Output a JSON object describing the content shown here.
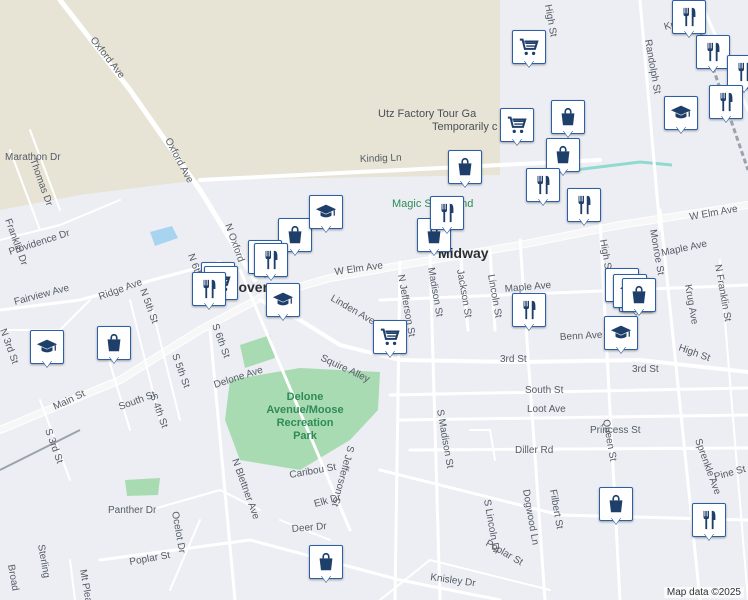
{
  "map": {
    "attribution": "Map data ©2025",
    "towns": [
      {
        "id": "hershey",
        "text": "Hanover"
      },
      {
        "id": "midway",
        "text": "Midway"
      }
    ],
    "pois": [
      {
        "id": "utz",
        "text": "Utz Factory Tour Ga"
      },
      {
        "id": "utz-status",
        "text": "Temporarily c"
      },
      {
        "id": "magic",
        "text": "Magic Skateland"
      }
    ],
    "park": [
      "Delone",
      "Avenue/Moose",
      "Recreation",
      "Park"
    ],
    "streets": [
      "Oxford Ave",
      "Oxford Ave",
      "W Elm Ave",
      "W Elm Ave",
      "Kindig Ln",
      "Main St",
      "Fairview Ave",
      "Ridge Ave",
      "Providence Dr",
      "Franklin Dr",
      "Thomas Dr",
      "Marathon Dr",
      "N 5th St",
      "N 3rd St",
      "N 6th St",
      "S 6th St",
      "S 5th St",
      "S 4th St",
      "S 3rd St",
      "South St",
      "Delone Ave",
      "Linden Ave",
      "Squire Alley",
      "N Jefferson St",
      "Madison St",
      "Jackson St",
      "Lincoln St",
      "Maple Ave",
      "Maple Ave",
      "Benn Ave",
      "3rd St",
      "3rd St",
      "South St",
      "Loot Ave",
      "Princess St",
      "Diller Rd",
      "High St",
      "S Madison St",
      "Caribou St",
      "Elk Dr",
      "Deer Dr",
      "Panther Dr",
      "Ocelot Dr",
      "Poplar St",
      "Poplar St",
      "N Blettner Ave",
      "S Jefferson St",
      "S Lincoln Dr",
      "Dogwood Ln",
      "Filbert St",
      "Mt Pleasant",
      "Knisley Dr",
      "Queen St",
      "Sprenkle Ave",
      "Pine St",
      "Krug Ave",
      "N Franklin St",
      "Monroe St",
      "Randolph St",
      "Kuhn Dr",
      "High St",
      "High St",
      "N Oxford",
      "Sterling",
      "Broad"
    ],
    "markers": [
      {
        "type": "shopping-cart"
      },
      {
        "type": "shopping-cart"
      },
      {
        "type": "shopping-cart"
      },
      {
        "type": "shopping-cart"
      },
      {
        "type": "shopping-cart"
      },
      {
        "type": "shopping-bag"
      },
      {
        "type": "shopping-bag"
      },
      {
        "type": "shopping-bag"
      },
      {
        "type": "shopping-bag"
      },
      {
        "type": "shopping-bag"
      },
      {
        "type": "shopping-bag"
      },
      {
        "type": "shopping-bag"
      },
      {
        "type": "shopping-bag"
      },
      {
        "type": "shopping-bag"
      },
      {
        "type": "shopping-bag"
      },
      {
        "type": "restaurant"
      },
      {
        "type": "restaurant"
      },
      {
        "type": "restaurant"
      },
      {
        "type": "restaurant"
      },
      {
        "type": "restaurant"
      },
      {
        "type": "restaurant"
      },
      {
        "type": "restaurant"
      },
      {
        "type": "restaurant"
      },
      {
        "type": "restaurant"
      },
      {
        "type": "restaurant"
      },
      {
        "type": "restaurant"
      },
      {
        "type": "restaurant"
      },
      {
        "type": "graduation-cap"
      },
      {
        "type": "graduation-cap"
      },
      {
        "type": "graduation-cap"
      },
      {
        "type": "graduation-cap"
      },
      {
        "type": "graduation-cap"
      },
      {
        "type": "graduation-cap"
      },
      {
        "type": "shopping-bag"
      },
      {
        "type": "shopping-bag"
      }
    ],
    "colors": {
      "marker_border": "#2b5fa8",
      "icon": "#1f3f6b",
      "park": "#a9dbb3",
      "water": "#a8d4f0",
      "land_tan": "#e7e4d6"
    }
  }
}
